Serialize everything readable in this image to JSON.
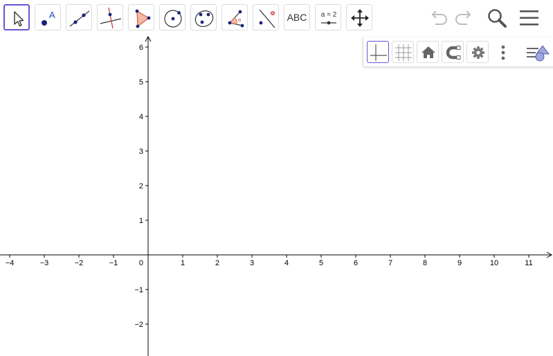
{
  "toolbar": {
    "tools": [
      {
        "name": "move-tool",
        "label": "",
        "selected": true
      },
      {
        "name": "point-tool",
        "label": "A"
      },
      {
        "name": "line-tool",
        "label": ""
      },
      {
        "name": "perpendicular-line-tool",
        "label": ""
      },
      {
        "name": "polygon-tool",
        "label": ""
      },
      {
        "name": "circle-center-point-tool",
        "label": ""
      },
      {
        "name": "ellipse-tool",
        "label": ""
      },
      {
        "name": "angle-tool",
        "label": "α"
      },
      {
        "name": "reflect-tool",
        "label": ""
      },
      {
        "name": "text-tool",
        "label": "ABC"
      },
      {
        "name": "slider-tool",
        "label": "a = 2"
      },
      {
        "name": "move-graphics-view-tool",
        "label": ""
      }
    ],
    "undo_icon": "undo-icon",
    "redo_icon": "redo-icon",
    "search_icon": "search-icon",
    "menu_icon": "menu-icon"
  },
  "style_bar": {
    "buttons": [
      {
        "name": "axes-toggle",
        "selected": true
      },
      {
        "name": "grid-toggle",
        "selected": false
      },
      {
        "name": "standard-view",
        "icon": "home-icon"
      },
      {
        "name": "point-capturing",
        "icon": "magnet-icon"
      },
      {
        "name": "graphics-settings",
        "icon": "gear-icon"
      },
      {
        "name": "more-options",
        "icon": "more-vertical-icon"
      },
      {
        "name": "toggle-algebra-view",
        "icon": "algebra-view-icon"
      }
    ]
  },
  "graph": {
    "x_tick_labels": [
      "−4",
      "−3",
      "−2",
      "−1",
      "1",
      "2",
      "3",
      "4",
      "5",
      "6",
      "7",
      "8",
      "9",
      "10",
      "11"
    ],
    "y_tick_labels": [
      "6",
      "5",
      "4",
      "3",
      "2",
      "1",
      "−1",
      "−2"
    ],
    "origin_label": "0",
    "x_range": [
      -4,
      11
    ],
    "y_range": [
      -2,
      6
    ],
    "grid": false,
    "axis_color": "#000000"
  },
  "colors": {
    "accent": "#6557d2",
    "point": "#1565c0",
    "polygon_fill": "#f4b9a8",
    "polygon_stroke": "#d35a3a",
    "toolbar_icon": "#333333",
    "disabled_icon": "#bdbdbd"
  }
}
